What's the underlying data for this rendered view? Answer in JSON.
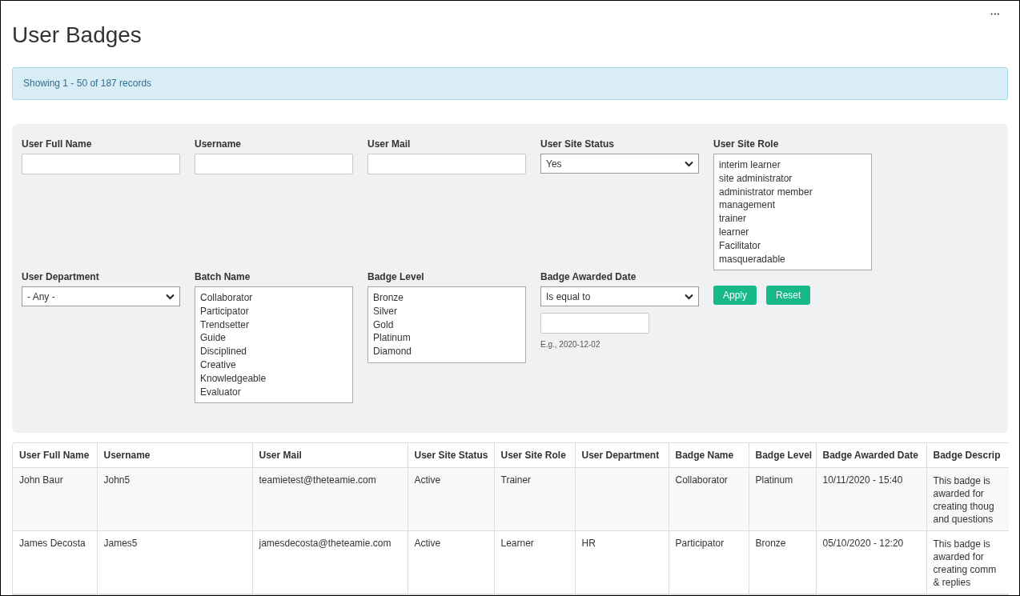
{
  "title": "User Badges",
  "more_menu": "•••",
  "alert": "Showing 1 - 50 of 187 records",
  "filters": [
    {
      "kind": "text",
      "label": "User Full Name"
    },
    {
      "kind": "text",
      "label": "Username"
    },
    {
      "kind": "text",
      "label": "User Mail"
    },
    {
      "kind": "select",
      "label": "User Site Status",
      "value": "Yes"
    },
    {
      "kind": "list",
      "label": "User Site Role",
      "options": [
        "interim learner",
        "site administrator",
        "administrator member",
        "management",
        "trainer",
        "learner",
        "Facilitator",
        "masqueradable"
      ]
    },
    {
      "kind": "select",
      "label": "User Department",
      "value": "- Any -"
    },
    {
      "kind": "list",
      "label": "Batch Name",
      "options": [
        "Collaborator",
        "Participator",
        "Trendsetter",
        "Guide",
        "Disciplined",
        "Creative",
        "Knowledgeable",
        "Evaluator"
      ]
    },
    {
      "kind": "list",
      "label": "Badge Level",
      "options": [
        "Bronze",
        "Silver",
        "Gold",
        "Platinum",
        "Diamond"
      ]
    },
    {
      "kind": "date",
      "label": "Badge Awarded Date",
      "value": "Is equal to",
      "hint": "E.g., 2020-12-02"
    }
  ],
  "buttons": [
    "Apply",
    "Reset"
  ],
  "table": {
    "columns": [
      "User Full Name",
      "Username",
      "User Mail",
      "User Site Status",
      "User Site Role",
      "User Department",
      "Badge Name",
      "Badge Level",
      "Badge Awarded Date",
      "Badge Descrip"
    ],
    "rows": [
      {
        "cells": [
          "John Baur",
          "John5",
          "teamietest@theteamie.com",
          "Active",
          "Trainer",
          "",
          "Collaborator",
          "Platinum",
          "10/11/2020 - 15:40"
        ],
        "description": [
          "This badge is",
          "awarded for",
          "creating thoug",
          "and questions"
        ]
      },
      {
        "cells": [
          "James Decosta",
          "James5",
          "jamesdecosta@theteamie.com",
          "Active",
          "Learner",
          "HR",
          "Participator",
          "Bronze",
          "05/10/2020 - 12:20"
        ],
        "description": [
          "This badge is",
          "awarded for",
          "creating comm",
          "& replies"
        ]
      }
    ]
  }
}
